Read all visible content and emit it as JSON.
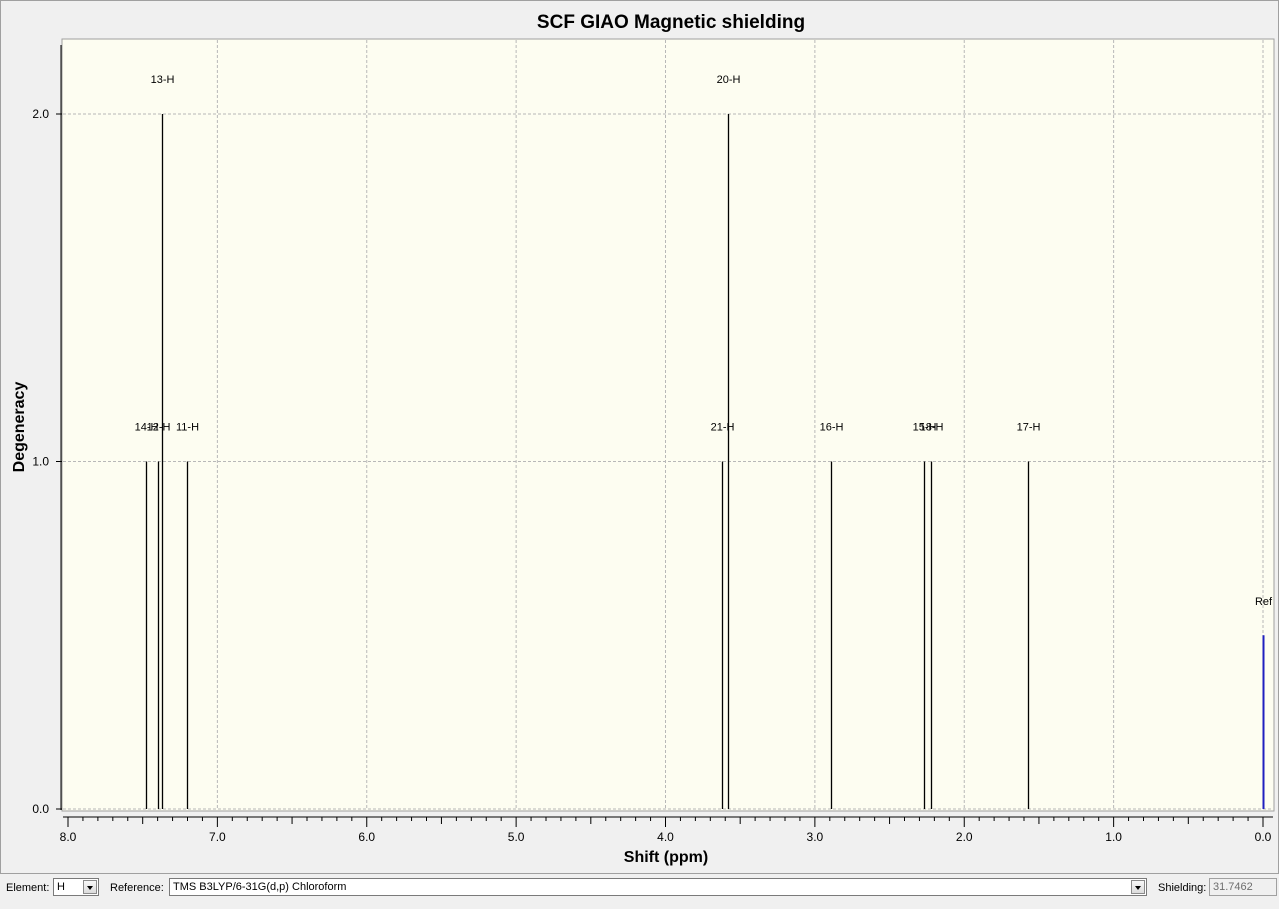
{
  "chart_data": {
    "type": "bar",
    "title": "SCF GIAO Magnetic shielding",
    "xlabel": "Shift (ppm)",
    "ylabel": "Degeneracy",
    "xlim": [
      8.0,
      0.0
    ],
    "ylim": [
      0.0,
      2.2
    ],
    "x_ticks": [
      "8.0",
      "7.0",
      "6.0",
      "5.0",
      "4.0",
      "3.0",
      "2.0",
      "1.0",
      "0.0"
    ],
    "y_ticks": [
      "0.0",
      "1.0",
      "2.0"
    ],
    "grid": true,
    "series": [
      {
        "points": [
          {
            "label": "14-H",
            "x": 7.48,
            "y": 1
          },
          {
            "label": "12-H",
            "x": 7.4,
            "y": 1
          },
          {
            "label": "13-H",
            "x": 7.37,
            "y": 2
          },
          {
            "label": "11-H",
            "x": 7.2,
            "y": 1
          },
          {
            "label": "21-H",
            "x": 3.62,
            "y": 1
          },
          {
            "label": "20-H",
            "x": 3.58,
            "y": 2
          },
          {
            "label": "16-H",
            "x": 2.89,
            "y": 1
          },
          {
            "label": "15-H",
            "x": 2.27,
            "y": 1
          },
          {
            "label": "18-H",
            "x": 2.22,
            "y": 1
          },
          {
            "label": "17-H",
            "x": 1.57,
            "y": 1
          }
        ]
      }
    ],
    "reference": {
      "label": "Ref",
      "x": 0.0,
      "y": 0.5,
      "color": "#1f1fbf"
    },
    "colors": {
      "plot_bg": "#fdfdf1",
      "line": "#000000",
      "grid": "#b8b8b8"
    }
  },
  "controls": {
    "element_label": "Element:",
    "element_value": "H",
    "reference_label": "Reference:",
    "reference_value": "TMS B3LYP/6-31G(d,p) Chloroform",
    "shielding_label": "Shielding:",
    "shielding_value": "31.7462"
  }
}
